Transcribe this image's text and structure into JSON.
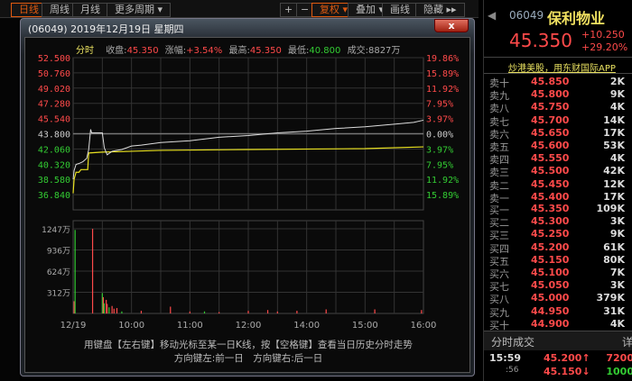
{
  "toolbar": {
    "left": [
      "日线",
      "周线",
      "月线",
      "更多周期 ▾"
    ],
    "right": [
      "+",
      "−",
      "复权 ▾",
      "叠加 ▾",
      "画线",
      "隐藏 ▸▸"
    ]
  },
  "dialog": {
    "title": "(06049) 2019年12月19日 星期四",
    "close": "x",
    "info": {
      "mode": "分时",
      "close_label": "收盘:",
      "close": "45.350",
      "chg_label": "涨幅:",
      "chg": "+3.54%",
      "high_label": "最高:",
      "high": "45.350",
      "low_label": "最低:",
      "low": "40.800",
      "vol_label": "成交:",
      "vol": "8827万"
    },
    "hint1": "用键盘【左右键】移动光标至某一日K线，按【空格键】查看当日历史分时走势",
    "hint2": "方向键左:前一日　方向键右:后一日"
  },
  "chart_data": {
    "type": "line",
    "base": 43.8,
    "y_labels": [
      "52.500",
      "50.760",
      "49.020",
      "47.280",
      "45.540",
      "43.800",
      "42.060",
      "40.320",
      "38.580",
      "36.840"
    ],
    "y_values": [
      52.5,
      50.76,
      49.02,
      47.28,
      45.54,
      43.8,
      42.06,
      40.32,
      38.58,
      36.84
    ],
    "pct_labels": [
      "19.86%",
      "15.89%",
      "11.92%",
      "7.95%",
      "3.97%",
      "0.00%",
      "3.97%",
      "7.95%",
      "11.92%",
      "15.89%"
    ],
    "vol_labels": [
      "1247万",
      "936万",
      "624万",
      "312万"
    ],
    "vol_values": [
      1247,
      936,
      624,
      312
    ],
    "x_labels": [
      "12/19",
      "10:00",
      "11:00",
      "12:00",
      "14:00",
      "15:00",
      "16:00"
    ],
    "price": [
      [
        "09:00",
        38.6
      ],
      [
        "09:01",
        39.6
      ],
      [
        "09:03",
        40.3
      ],
      [
        "09:06",
        40.4
      ],
      [
        "09:10",
        40.6
      ],
      [
        "09:14",
        41.0
      ],
      [
        "09:16",
        42.0
      ],
      [
        "09:18",
        44.3
      ],
      [
        "09:19",
        43.9
      ],
      [
        "09:30",
        43.9
      ],
      [
        "09:32",
        42.2
      ],
      [
        "09:35",
        41.4
      ],
      [
        "09:40",
        41.8
      ],
      [
        "09:50",
        42.0
      ],
      [
        "10:00",
        42.4
      ],
      [
        "10:10",
        42.5
      ],
      [
        "10:30",
        42.8
      ],
      [
        "11:00",
        43.0
      ],
      [
        "11:30",
        43.4
      ],
      [
        "12:00",
        43.6
      ],
      [
        "13:30",
        43.9
      ],
      [
        "14:00",
        44.1
      ],
      [
        "14:30",
        44.4
      ],
      [
        "15:00",
        44.6
      ],
      [
        "15:30",
        44.9
      ],
      [
        "15:50",
        45.1
      ],
      [
        "16:00",
        45.35
      ]
    ],
    "avg": [
      [
        "09:00",
        37.0
      ],
      [
        "09:01",
        38.6
      ],
      [
        "09:03",
        39.4
      ],
      [
        "09:06",
        39.4
      ],
      [
        "09:08",
        39.7
      ],
      [
        "09:15",
        39.7
      ],
      [
        "09:16",
        41.6
      ],
      [
        "09:30",
        41.7
      ],
      [
        "10:00",
        41.8
      ],
      [
        "10:30",
        41.9
      ],
      [
        "12:00",
        42.0
      ],
      [
        "15:00",
        42.1
      ],
      [
        "16:00",
        42.3
      ]
    ],
    "volume": [
      [
        "09:01",
        180,
        "r"
      ],
      [
        "09:02",
        1230,
        "g"
      ],
      [
        "09:20",
        1247,
        "r"
      ],
      [
        "09:30",
        300,
        "g"
      ],
      [
        "09:31",
        240,
        "r"
      ],
      [
        "09:32",
        150,
        "g"
      ],
      [
        "09:34",
        200,
        "r"
      ],
      [
        "09:35",
        140,
        "r"
      ],
      [
        "09:37",
        90,
        "g"
      ],
      [
        "09:40",
        110,
        "r"
      ],
      [
        "09:42",
        70,
        "r"
      ],
      [
        "09:45",
        80,
        "r"
      ],
      [
        "09:50",
        30,
        "g"
      ],
      [
        "10:10",
        40,
        "r"
      ],
      [
        "10:40",
        100,
        "r"
      ],
      [
        "11:00",
        30,
        "r"
      ],
      [
        "11:15",
        30,
        "g"
      ],
      [
        "11:30",
        20,
        "r"
      ],
      [
        "12:00",
        40,
        "r"
      ],
      [
        "12:30",
        30,
        "r"
      ],
      [
        "13:20",
        50,
        "r"
      ],
      [
        "13:50",
        40,
        "r"
      ],
      [
        "14:20",
        60,
        "r"
      ],
      [
        "15:10",
        60,
        "r"
      ],
      [
        "15:58",
        50,
        "r"
      ]
    ]
  },
  "quote": {
    "code": "06049",
    "name": "保利物业",
    "price": "45.350",
    "chg": "+10.250",
    "pct": "+29.20%",
    "ad": "炒港美股，用东财国际APP",
    "asks": [
      [
        "卖十",
        "45.850",
        "2K"
      ],
      [
        "卖九",
        "45.800",
        "9K"
      ],
      [
        "卖八",
        "45.750",
        "4K"
      ],
      [
        "卖七",
        "45.700",
        "14K"
      ],
      [
        "卖六",
        "45.650",
        "17K"
      ],
      [
        "卖五",
        "45.600",
        "53K"
      ],
      [
        "卖四",
        "45.550",
        "4K"
      ],
      [
        "卖三",
        "45.500",
        "42K"
      ],
      [
        "卖二",
        "45.450",
        "12K"
      ],
      [
        "卖一",
        "45.400",
        "17K"
      ]
    ],
    "bids": [
      [
        "买一",
        "45.350",
        "109K"
      ],
      [
        "买二",
        "45.300",
        "3K"
      ],
      [
        "买三",
        "45.250",
        "9K"
      ],
      [
        "买四",
        "45.200",
        "61K"
      ],
      [
        "买五",
        "45.150",
        "80K"
      ],
      [
        "买六",
        "45.100",
        "7K"
      ],
      [
        "买七",
        "45.050",
        "3K"
      ],
      [
        "买八",
        "45.000",
        "379K"
      ],
      [
        "买九",
        "44.950",
        "31K"
      ],
      [
        "买十",
        "44.900",
        "4K"
      ]
    ],
    "ticks_title": "分时成交",
    "detail": "详",
    "ticks": [
      [
        "15:59",
        "45.200↑",
        "7200"
      ],
      [
        ":56",
        "45.150↓",
        "1000"
      ]
    ]
  }
}
